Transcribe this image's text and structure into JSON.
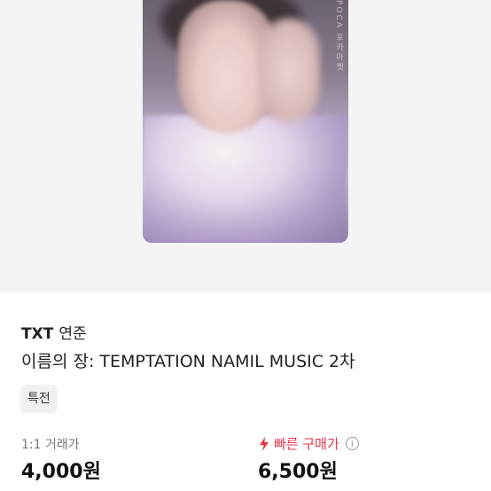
{
  "product": {
    "artist": "TXT",
    "member": "연준",
    "title": "이름의 장: TEMPTATION NAMIL MUSIC 2차",
    "tag": "특전",
    "image_watermark": "POCA 포카마켓"
  },
  "pricing": {
    "trade_label": "1:1 거래가",
    "trade_price": "4,000원",
    "quick_label": "빠른 구매가",
    "quick_price": "6,500원",
    "quick_color": "#e8344a"
  },
  "icons": {
    "quick_icon": "lightning-icon",
    "info_icon": "info-icon"
  }
}
